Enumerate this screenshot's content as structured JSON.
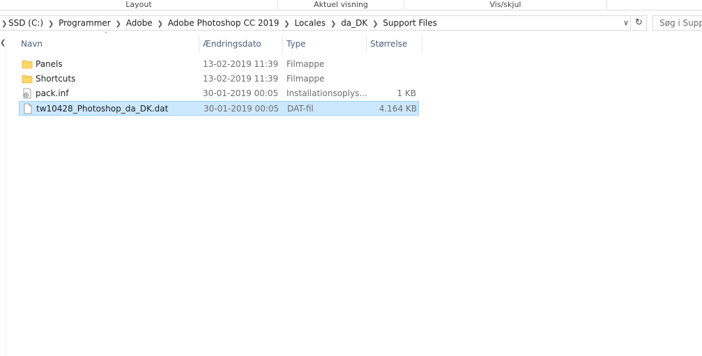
{
  "ribbon": {
    "groups": [
      "Layout",
      "Aktuel visning",
      "Vis/skjul"
    ]
  },
  "address_bar": {
    "crumbs": [
      "SSD (C:)",
      "Programmer",
      "Adobe",
      "Adobe Photoshop CC 2019",
      "Locales",
      "da_DK",
      "Support Files"
    ],
    "dropdown_icon": "chevron-down-icon",
    "refresh_icon": "refresh-icon"
  },
  "search": {
    "placeholder": "Søg i Support Files"
  },
  "columns": {
    "name": "Navn",
    "date": "Ændringsdato",
    "type": "Type",
    "size": "Størrelse"
  },
  "files": [
    {
      "name": "Panels",
      "date": "13-02-2019 11:39",
      "type": "Filmappe",
      "size": "",
      "icon": "folder-icon",
      "selected": false
    },
    {
      "name": "Shortcuts",
      "date": "13-02-2019 11:39",
      "type": "Filmappe",
      "size": "",
      "icon": "folder-icon",
      "selected": false
    },
    {
      "name": "pack.inf",
      "date": "30-01-2019 00:05",
      "type": "Installationsoplys...",
      "size": "1 KB",
      "icon": "settings-file-icon",
      "selected": false
    },
    {
      "name": "tw10428_Photoshop_da_DK.dat",
      "date": "30-01-2019 00:05",
      "type": "DAT-fil",
      "size": "4.164 KB",
      "icon": "file-icon",
      "selected": true
    }
  ],
  "colors": {
    "selection_fill": "#cce8ff",
    "selection_border": "#99d1ff",
    "folder": "#ffd866",
    "header_text": "#4c607a"
  }
}
